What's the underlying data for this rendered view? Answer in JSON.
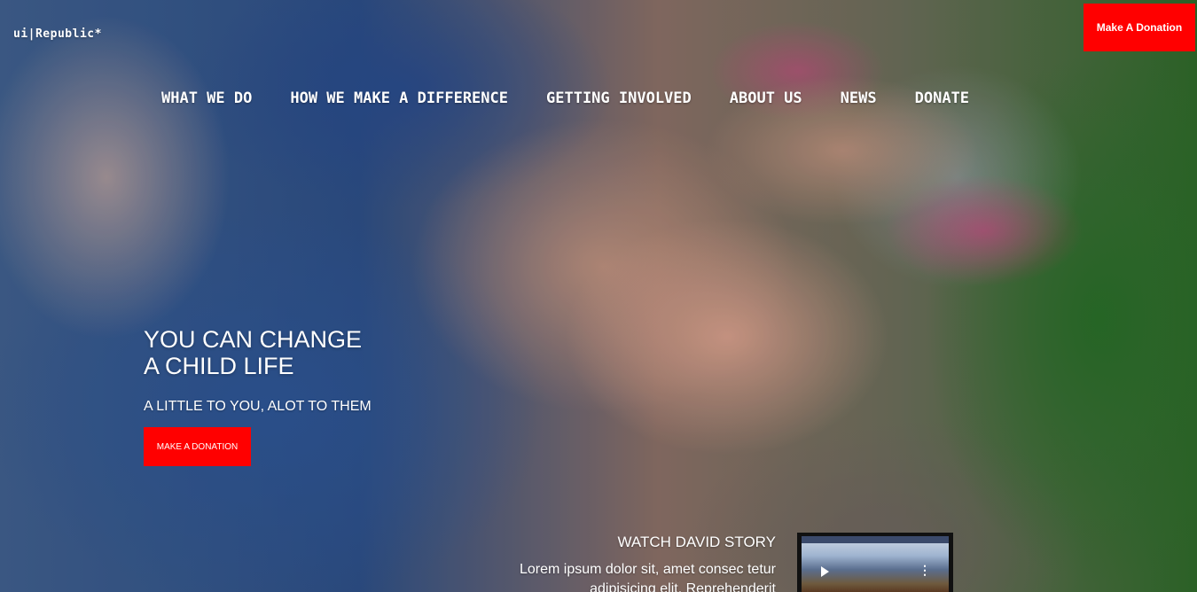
{
  "brand": {
    "logo_text": "ui|Republic*"
  },
  "header": {
    "donate_button": "Make A Donation"
  },
  "nav": {
    "items": [
      {
        "label": "WHAT WE DO"
      },
      {
        "label": "HOW WE MAKE A DIFFERENCE"
      },
      {
        "label": "GETTING INVOLVED"
      },
      {
        "label": "ABOUT US"
      },
      {
        "label": "NEWS"
      },
      {
        "label": "DONATE"
      }
    ]
  },
  "hero": {
    "headline_line1": "YOU CAN CHANGE",
    "headline_line2": "A CHILD LIFE",
    "tagline": "A LITTLE TO YOU, ALOT TO THEM",
    "cta_button": "MAKE A DONATION"
  },
  "story": {
    "title": "WATCH DAVID STORY",
    "text": "Lorem ipsum dolor sit, amet consec tetur adipisicing elit. Reprehenderit"
  },
  "video": {
    "play_icon": "play-icon",
    "more_icon": "more-vertical-icon"
  },
  "colors": {
    "accent": "#ff0000",
    "text": "#ffffff"
  }
}
